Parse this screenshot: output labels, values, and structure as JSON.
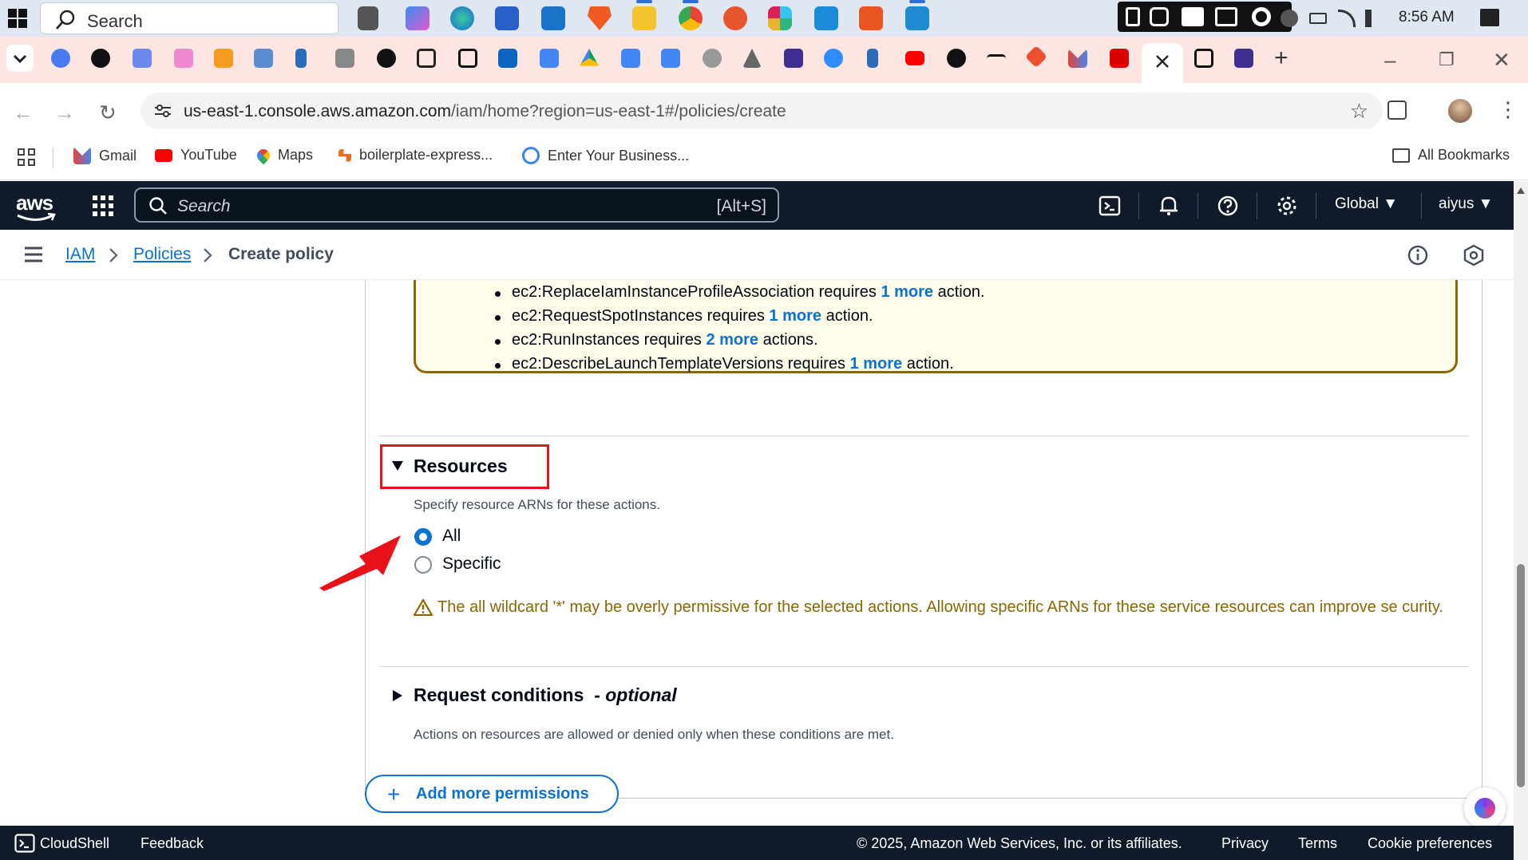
{
  "taskbar": {
    "search_label": "Search",
    "clock": "8:56 AM"
  },
  "browser": {
    "url_host": "us-east-1.console.aws.amazon.com",
    "url_path": "/iam/home?region=us-east-1#/policies/create",
    "bookmarks": [
      "Gmail",
      "YouTube",
      "Maps",
      "boilerplate-express...",
      "Enter Your Business..."
    ],
    "all_bookmarks": "All Bookmarks"
  },
  "aws_header": {
    "logo": "aws",
    "search_placeholder": "Search",
    "search_shortcut": "[Alt+S]",
    "region": "Global ▼",
    "user": "aiyus ▼"
  },
  "breadcrumb": {
    "items": [
      "IAM",
      "Policies",
      "Create policy"
    ]
  },
  "warning_list": [
    {
      "action": "ec2:ReplaceIamInstanceProfileAssociation requires ",
      "link": "1 more",
      "tail": " action."
    },
    {
      "action": "ec2:RequestSpotInstances requires ",
      "link": "1 more",
      "tail": " action."
    },
    {
      "action": "ec2:RunInstances requires ",
      "link": "2 more",
      "tail": " actions."
    },
    {
      "action": "ec2:DescribeLaunchTemplateVersions requires ",
      "link": "1 more",
      "tail": " action."
    }
  ],
  "resources": {
    "title": "Resources",
    "description": "Specify resource ARNs for these actions.",
    "options": [
      "All",
      "Specific"
    ],
    "selected": "All",
    "wildcard_warning": "The all wildcard '*' may be overly permissive for the selected actions. Allowing specific ARNs for these service resources can improve se curity."
  },
  "request_conditions": {
    "title": "Request conditions",
    "optional": "- optional",
    "description": "Actions on resources are allowed or denied only when these conditions are met."
  },
  "add_permissions_label": "Add more permissions",
  "footer": {
    "cloudshell": "CloudShell",
    "feedback": "Feedback",
    "copyright": "© 2025, Amazon Web Services, Inc. or its affiliates.",
    "privacy": "Privacy",
    "terms": "Terms",
    "cookies": "Cookie preferences"
  },
  "colors": {
    "aws_dark": "#0f1b2a",
    "link_blue": "#0972d3",
    "warning_brown": "#8d6605",
    "highlight_red": "#e8111a"
  }
}
